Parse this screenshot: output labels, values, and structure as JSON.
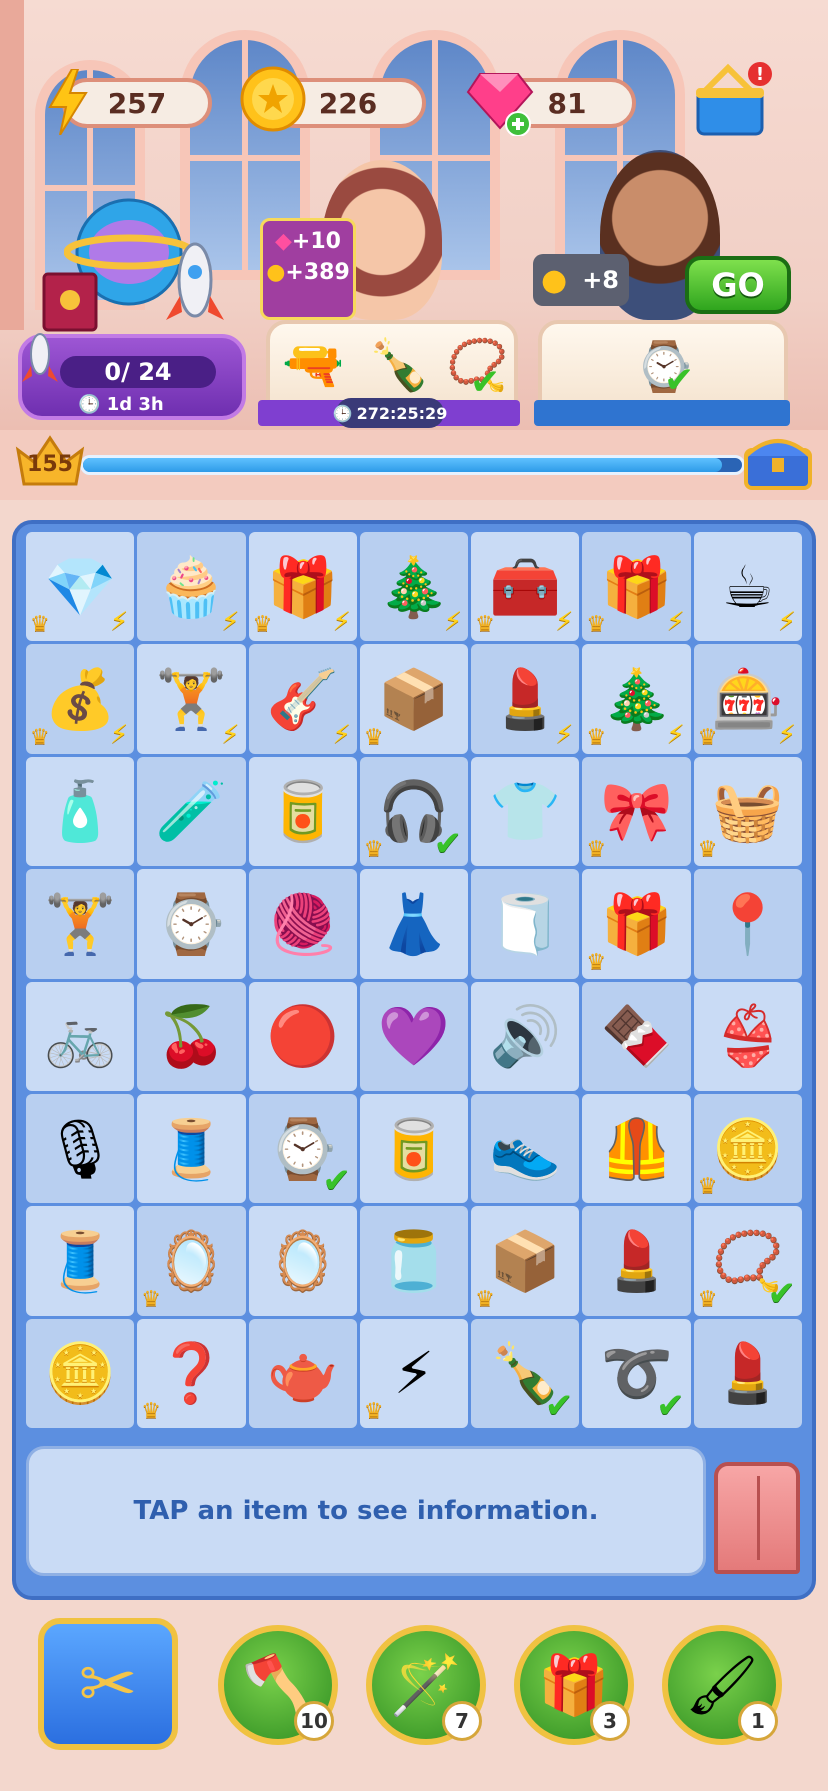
{
  "resources": {
    "energy": {
      "value": "257",
      "icon": "lightning-icon"
    },
    "coins": {
      "value": "226",
      "icon": "coin-icon"
    },
    "gems": {
      "value": "81",
      "icon": "gem-icon"
    },
    "shop": {
      "icon": "basket-icon",
      "alert": "!"
    }
  },
  "event": {
    "progress": "0/ 24",
    "time": "1d 3h"
  },
  "orders": [
    {
      "reward_gems": "+10",
      "reward_coins": "+389",
      "timer": "272:25:29",
      "items": [
        "hair-dryer-icon",
        "bottle-icon",
        "pearl-necklace-icon"
      ]
    },
    {
      "reward_coins": "+8",
      "go_label": "GO",
      "items": [
        "wristwatch-icon"
      ]
    }
  ],
  "level": {
    "value": "155",
    "progress": 0.97
  },
  "board": {
    "cells": [
      {
        "g": "💎",
        "n": "jewelry-chest-icon",
        "crown": true,
        "bolt": true
      },
      {
        "g": "🧁",
        "n": "vanity-desk-icon",
        "crown": false,
        "bolt": true
      },
      {
        "g": "🎁",
        "n": "toy-car-icon",
        "crown": true,
        "bolt": true
      },
      {
        "g": "🎄",
        "n": "christmas-tree-icon",
        "crown": false,
        "bolt": true
      },
      {
        "g": "🧰",
        "n": "makeup-box-icon",
        "crown": true,
        "bolt": true
      },
      {
        "g": "🎁",
        "n": "gift-box-icon",
        "crown": true,
        "bolt": true
      },
      {
        "g": "☕",
        "n": "coffee-maker-icon",
        "crown": false,
        "bolt": true
      },
      {
        "g": "💰",
        "n": "money-bag-icon",
        "crown": true,
        "bolt": true
      },
      {
        "g": "🏋",
        "n": "gym-bag-icon",
        "crown": false,
        "bolt": true
      },
      {
        "g": "🎸",
        "n": "guitar-case-icon",
        "crown": false,
        "bolt": true
      },
      {
        "g": "📦",
        "n": "coin-crate-icon",
        "crown": true,
        "bolt": false
      },
      {
        "g": "💄",
        "n": "makeup-palette-icon",
        "crown": false,
        "bolt": true
      },
      {
        "g": "🎄",
        "n": "golden-trees-icon",
        "crown": true,
        "bolt": true
      },
      {
        "g": "🎰",
        "n": "vending-machine-icon",
        "crown": true,
        "bolt": true
      },
      {
        "g": "🧴",
        "n": "perfume-icon",
        "crown": false,
        "bolt": false
      },
      {
        "g": "🧪",
        "n": "lipstick-tube-icon",
        "crown": false,
        "bolt": false
      },
      {
        "g": "🥫",
        "n": "energy-can-icon",
        "crown": false,
        "bolt": false
      },
      {
        "g": "🎧",
        "n": "headphones-icon",
        "crown": true,
        "check": true
      },
      {
        "g": "👕",
        "n": "tshirt-icon",
        "crown": false,
        "bolt": false
      },
      {
        "g": "🎀",
        "n": "pink-bow-icon",
        "crown": true,
        "bolt": false
      },
      {
        "g": "🧺",
        "n": "sewing-basket-icon",
        "crown": true,
        "bolt": false
      },
      {
        "g": "🏋",
        "n": "dumbbells-icon",
        "crown": false,
        "bolt": false
      },
      {
        "g": "⌚",
        "n": "smartwatch-icon",
        "crown": false,
        "bolt": false
      },
      {
        "g": "🧶",
        "n": "fabric-stack-icon",
        "crown": false,
        "bolt": false
      },
      {
        "g": "👗",
        "n": "dress-icon",
        "crown": false,
        "bolt": false
      },
      {
        "g": "🧻",
        "n": "yoga-mat-icon",
        "crown": false,
        "bolt": false
      },
      {
        "g": "🎁",
        "n": "present-icon",
        "crown": true,
        "bolt": false
      },
      {
        "g": "📍",
        "n": "pin-cushion-icon",
        "crown": false,
        "bolt": false
      },
      {
        "g": "🚲",
        "n": "exercise-bike-icon",
        "crown": false,
        "bolt": false
      },
      {
        "g": "🍒",
        "n": "cherry-soda-icon",
        "crown": false,
        "bolt": false
      },
      {
        "g": "🔴",
        "n": "belt-icon",
        "crown": false,
        "bolt": false
      },
      {
        "g": "💜",
        "n": "earrings-icon",
        "crown": false,
        "bolt": false
      },
      {
        "g": "🔊",
        "n": "speaker-icon",
        "crown": false,
        "bolt": false
      },
      {
        "g": "🍫",
        "n": "chocolate-bar-icon",
        "crown": false,
        "bolt": false
      },
      {
        "g": "👙",
        "n": "camisole-icon",
        "crown": false,
        "bolt": false
      },
      {
        "g": "🎙",
        "n": "microphone-icon",
        "crown": false,
        "bolt": false
      },
      {
        "g": "🧵",
        "n": "yarn-box-icon",
        "crown": false,
        "bolt": false
      },
      {
        "g": "⌚",
        "n": "gold-watch-icon",
        "crown": false,
        "check": true
      },
      {
        "g": "🥫",
        "n": "lime-soda-icon",
        "crown": false,
        "bolt": false
      },
      {
        "g": "👟",
        "n": "sneakers-icon",
        "crown": false,
        "bolt": false
      },
      {
        "g": "🦺",
        "n": "green-top-icon",
        "crown": false,
        "bolt": false
      },
      {
        "g": "🪙",
        "n": "treasure-chest-icon",
        "crown": true,
        "bolt": false
      },
      {
        "g": "🧵",
        "n": "thread-spool-icon",
        "crown": false,
        "bolt": false
      },
      {
        "g": "🪞",
        "n": "hand-mirror-icon",
        "crown": true,
        "bolt": false
      },
      {
        "g": "🪞",
        "n": "compact-mirror-icon",
        "crown": false,
        "bolt": false
      },
      {
        "g": "🫙",
        "n": "cream-jar-icon",
        "crown": false,
        "bolt": false
      },
      {
        "g": "📦",
        "n": "energy-chest-icon",
        "crown": true,
        "bolt": false
      },
      {
        "g": "💄",
        "n": "eyeshadow-compact-icon",
        "crown": false,
        "bolt": false
      },
      {
        "g": "📿",
        "n": "pearl-necklace-icon",
        "crown": true,
        "check": true
      },
      {
        "g": "🪙",
        "n": "silver-coins-icon",
        "crown": false,
        "bolt": false
      },
      {
        "g": "❓",
        "n": "mystery-dome-icon",
        "crown": true,
        "bolt": false
      },
      {
        "g": "🫖",
        "n": "coffee-pot-icon",
        "crown": false,
        "bolt": false
      },
      {
        "g": "⚡",
        "n": "energy-pile-icon",
        "crown": true,
        "bolt": false
      },
      {
        "g": "🍾",
        "n": "bottle-icon",
        "crown": false,
        "check": true
      },
      {
        "g": "➰",
        "n": "jump-rope-icon",
        "crown": false,
        "check": true
      },
      {
        "g": "💄",
        "n": "powder-compact-icon",
        "crown": false,
        "bolt": false
      }
    ]
  },
  "info": {
    "text": "TAP an item to see information."
  },
  "toolbar": {
    "scissors": {
      "icon": "scissors-icon"
    },
    "tools": [
      {
        "icon": "axe-icon",
        "g": "🪓",
        "count": "10"
      },
      {
        "icon": "magic-wand-icon",
        "g": "🪄",
        "count": "7"
      },
      {
        "icon": "mystery-box-icon",
        "g": "🎁",
        "count": "3"
      },
      {
        "icon": "paintbrush-icon",
        "g": "🖌",
        "count": "1"
      }
    ]
  }
}
